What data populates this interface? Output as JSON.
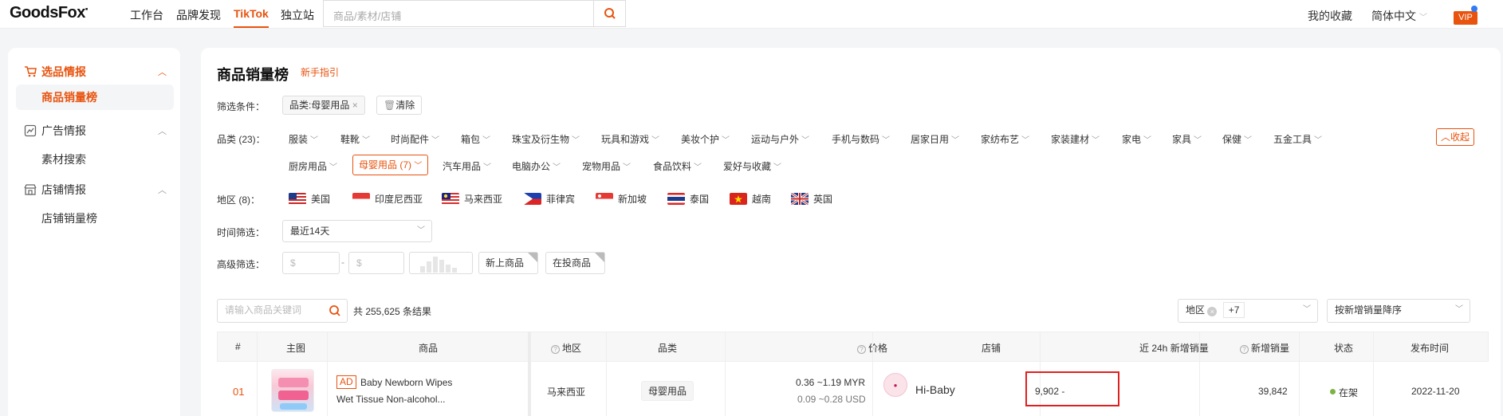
{
  "header": {
    "logo": "GoodsFox",
    "nav": [
      {
        "label": "工作台"
      },
      {
        "label": "品牌发现"
      },
      {
        "label": "TikTok"
      },
      {
        "label": "独立站"
      }
    ],
    "search_placeholder": "商品/素材/店铺",
    "favorites": "我的收藏",
    "language": "简体中文",
    "vip": "VIP"
  },
  "sidebar": {
    "groups": [
      {
        "label": "选品情报",
        "icon": "cart-icon",
        "items": [
          {
            "label": "商品销量榜"
          }
        ]
      },
      {
        "label": "广告情报",
        "icon": "ad-icon",
        "items": [
          {
            "label": "素材搜索"
          }
        ]
      },
      {
        "label": "店铺情报",
        "icon": "store-icon",
        "items": [
          {
            "label": "店铺销量榜"
          }
        ]
      }
    ]
  },
  "main": {
    "title": "商品销量榜",
    "guide": "新手指引",
    "filter_label": "筛选条件：",
    "filter_chip": "品类:母婴用品",
    "clear": "清除",
    "category_label": "品类 (23)：",
    "categories_row1": [
      "服装",
      "鞋靴",
      "时尚配件",
      "箱包",
      "珠宝及衍生物",
      "玩具和游戏",
      "美妆个护",
      "运动与户外",
      "手机与数码",
      "居家日用",
      "家纺布艺",
      "家装建材",
      "家电",
      "家具",
      "保健",
      "五金工具"
    ],
    "categories_row2": [
      "厨房用品",
      "母婴用品 (7)",
      "汽车用品",
      "电脑办公",
      "宠物用品",
      "食品饮料",
      "爱好与收藏"
    ],
    "collapse": "收起",
    "region_label": "地区 (8)：",
    "regions": [
      "美国",
      "印度尼西亚",
      "马来西亚",
      "菲律宾",
      "新加坡",
      "泰国",
      "越南",
      "英国"
    ],
    "time_label": "时间筛选：",
    "time_value": "最近14天",
    "advanced_label": "高级筛选：",
    "price_min_placeholder": "$",
    "price_max_placeholder": "$",
    "range_dash": "-",
    "new_products": "新上商品",
    "on_ad": "在投商品",
    "keyword_placeholder": "请输入商品关键词",
    "result_count": "共 255,625 条结果",
    "region_select_label": "地区",
    "region_select_extra": "+7",
    "sort_value": "按新增销量降序"
  },
  "table": {
    "headers": [
      "#",
      "主图",
      "商品",
      "地区",
      "品类",
      "价格",
      "店铺",
      "近 24h 新增销量",
      "新增销量",
      "状态",
      "发布时间"
    ],
    "rows": [
      {
        "rank": "01",
        "ad": "AD",
        "title_line1": "Baby Newborn Wipes",
        "title_line2": "Wet Tissue Non-alcohol...",
        "region": "马来西亚",
        "category": "母婴用品",
        "price_local": "0.36 ~1.19 MYR",
        "price_usd": "0.09 ~0.28 USD",
        "store": "Hi-Baby",
        "sales_24h": "9,902 -",
        "new_sales": "39,842",
        "status": "在架",
        "publish_date": "2022-11-20"
      }
    ]
  },
  "colors": {
    "accent": "#e8530e",
    "status_green": "#7cb342",
    "highlight_box": "#e02020"
  }
}
